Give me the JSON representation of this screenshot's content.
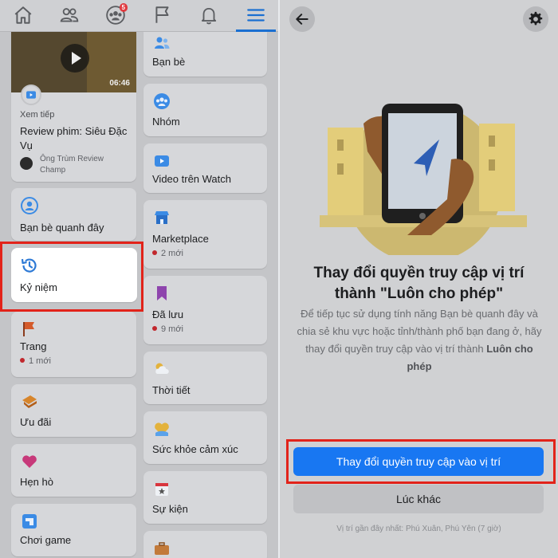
{
  "nav": {
    "tabs": [
      {
        "icon": "home-icon"
      },
      {
        "icon": "friends-icon"
      },
      {
        "icon": "groups-icon",
        "badge": "5"
      },
      {
        "icon": "flag-icon"
      },
      {
        "icon": "bell-icon"
      },
      {
        "icon": "menu-icon",
        "active": true
      }
    ]
  },
  "video": {
    "duration": "06:46",
    "label": "Xem tiếp",
    "title": "Review phim: Siêu Đặc Vụ",
    "author": "Ông Trùm Review Champ"
  },
  "left_items": [
    {
      "label": "Bạn bè quanh đây",
      "icon": "nearby-friends-icon"
    },
    {
      "label": "Kỷ niệm",
      "icon": "memories-icon",
      "highlighted": true
    },
    {
      "label": "Trang",
      "sub": "1 mới",
      "icon": "flag-icon"
    },
    {
      "label": "Ưu đãi",
      "icon": "offers-icon"
    },
    {
      "label": "Hẹn hò",
      "icon": "dating-icon"
    },
    {
      "label": "Chơi game",
      "icon": "gaming-icon"
    }
  ],
  "right_items": [
    {
      "label": "Bạn bè",
      "icon": "friends-icon"
    },
    {
      "label": "Nhóm",
      "icon": "groups-icon"
    },
    {
      "label": "Video trên Watch",
      "icon": "watch-icon"
    },
    {
      "label": "Marketplace",
      "sub": "2 mới",
      "icon": "marketplace-icon"
    },
    {
      "label": "Đã lưu",
      "sub": "9 mới",
      "icon": "saved-icon"
    },
    {
      "label": "Thời tiết",
      "icon": "weather-icon"
    },
    {
      "label": "Sức khỏe cảm xúc",
      "icon": "emotional-health-icon"
    },
    {
      "label": "Sự kiện",
      "icon": "events-icon"
    }
  ],
  "permission": {
    "title_line1": "Thay đổi quyền truy cập vị trí",
    "title_line2": "thành \"Luôn cho phép\"",
    "desc": "Để tiếp tục sử dụng tính năng Bạn bè quanh đây và chia sẻ khu vực hoặc tỉnh/thành phố bạn đang ở, hãy thay đổi quyền truy cập vào vị trí thành",
    "desc_bold": "Luôn cho phép",
    "primary_button": "Thay đổi quyền truy cập vào vị trí",
    "secondary_button": "Lúc khác",
    "location_note": "Vị trí gần đây nhất: Phú Xuân, Phú Yên (7 giờ)"
  },
  "colors": {
    "primary": "#1877f2",
    "highlight": "#e2231a",
    "badge": "#e0393e"
  }
}
